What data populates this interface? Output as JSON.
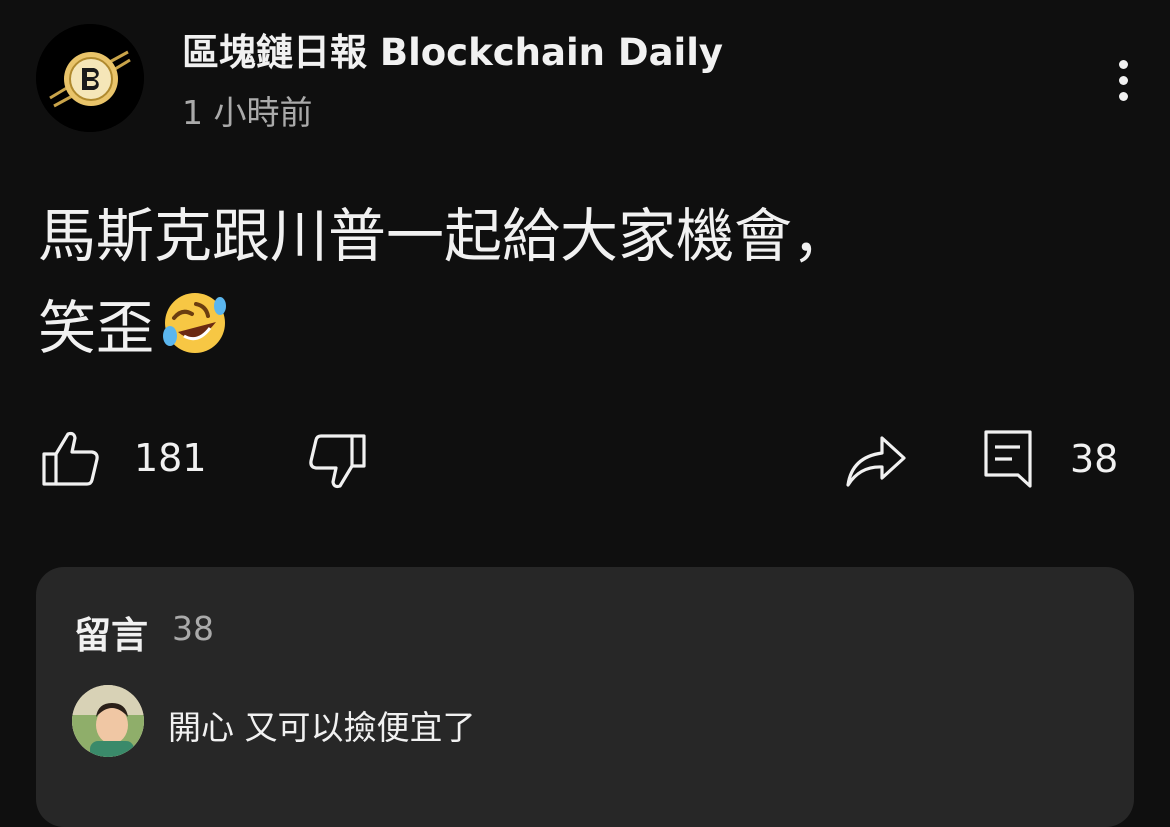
{
  "header": {
    "channel_name": "區塊鏈日報 Blockchain Daily",
    "time_ago": "1 小時前",
    "avatar_icon": "blockchain-daily-logo",
    "more_icon": "more-vertical-icon"
  },
  "post": {
    "line1": "馬斯克跟川普一起給大家機會，",
    "line2": "笑歪",
    "emoji": "rolling-on-the-floor-laughing-emoji"
  },
  "actions": {
    "like_icon": "thumbs-up-icon",
    "like_count": "181",
    "dislike_icon": "thumbs-down-icon",
    "share_icon": "share-icon",
    "comment_icon": "comment-icon",
    "comment_count": "38"
  },
  "comments": {
    "title": "留言",
    "count": "38",
    "top_comment": {
      "text": "開心 又可以撿便宜了"
    }
  },
  "colors": {
    "background": "#0f0f0f",
    "card": "#272727",
    "text_primary": "#f1f1f1",
    "text_secondary": "#aaaaaa",
    "logo_gold": "#e9c46a"
  }
}
